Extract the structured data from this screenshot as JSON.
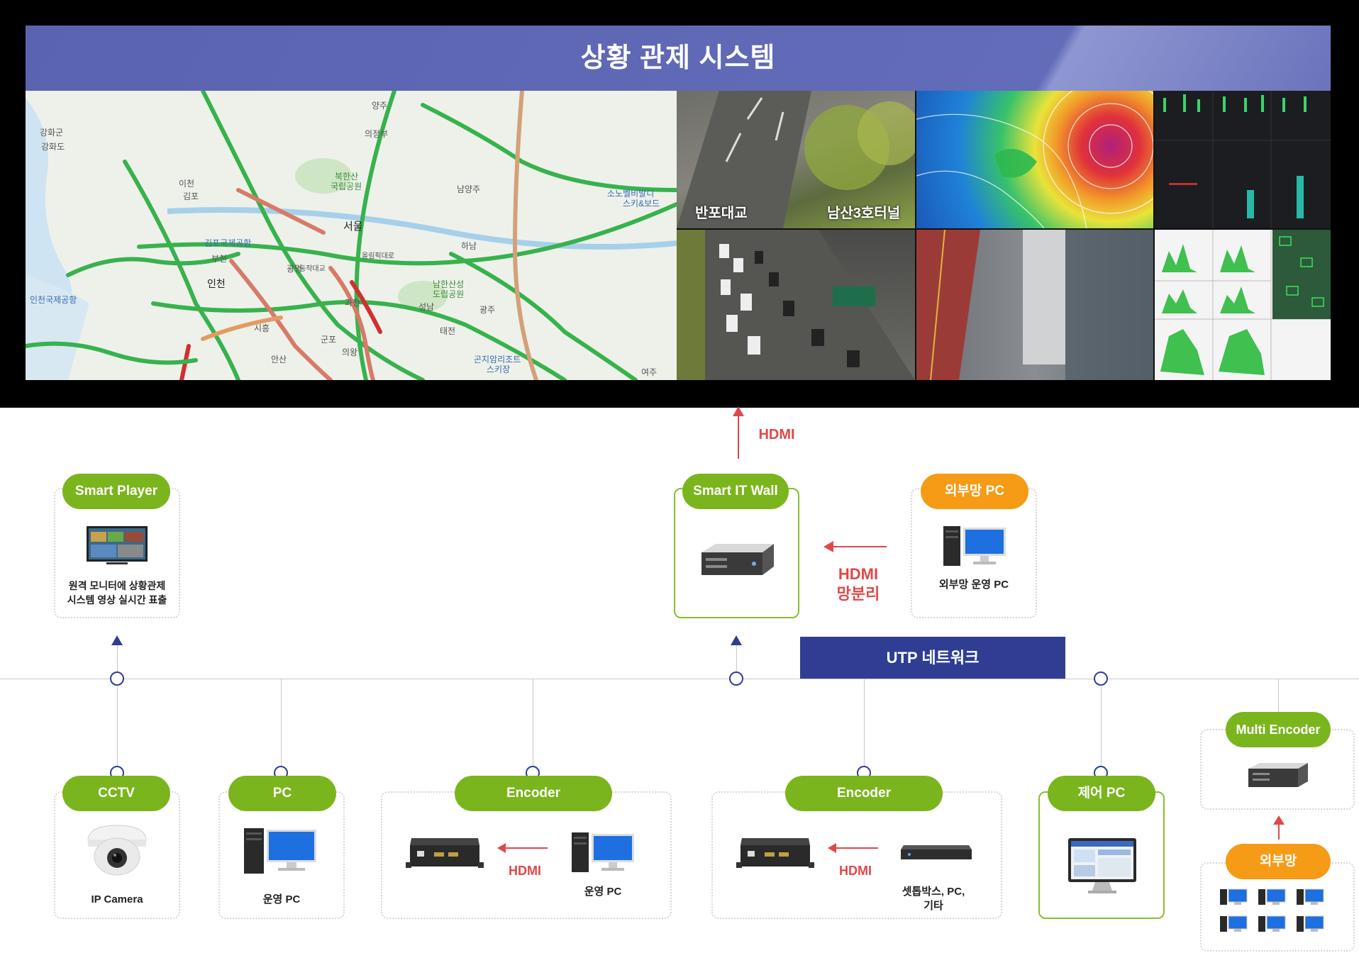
{
  "wall": {
    "title": "상황 관제 시스템",
    "map_labels": [
      "강화군",
      "강화도",
      "김포",
      "이천",
      "양주",
      "의정부",
      "북한산",
      "국립공원",
      "남양주",
      "서울",
      "광명",
      "인천",
      "시흥",
      "안산",
      "군포",
      "의왕",
      "과천",
      "성남",
      "하남",
      "남한산성",
      "도립공원",
      "곤지암리조트",
      "스키장",
      "여주",
      "부천",
      "김포국제공항",
      "인천국제공항",
      "소노벨비발디",
      "스키&보드",
      "광주",
      "태전",
      "동작대교",
      "올림픽대로"
    ],
    "cctv_labels": [
      "반포대교",
      "남산3호터널"
    ]
  },
  "diagram": {
    "hdmi_up": "HDMI",
    "smart_player": {
      "title": "Smart Player",
      "caption_line1": "원격 모니터에 상황관제",
      "caption_line2": "시스템 영상 실시간 표출"
    },
    "smart_it_wall": {
      "title": "Smart IT Wall"
    },
    "ext_pc": {
      "title": "외부망 PC",
      "caption": "외부망 운영 PC"
    },
    "hdmi_split": {
      "line1": "HDMI",
      "line2": "망분리"
    },
    "utp": "UTP 네트워크",
    "cctv": {
      "title": "CCTV",
      "caption": "IP Camera"
    },
    "pc": {
      "title": "PC",
      "caption": "운영 PC"
    },
    "encoder1": {
      "title": "Encoder",
      "hdmi": "HDMI",
      "caption": "운영 PC"
    },
    "encoder2": {
      "title": "Encoder",
      "hdmi": "HDMI",
      "caption_line1": "셋톱박스, PC,",
      "caption_line2": "기타"
    },
    "control_pc": {
      "title": "제어 PC"
    },
    "multi_encoder": {
      "title": "Multi Encoder"
    },
    "ext_net": {
      "title": "외부망"
    },
    "colors": {
      "green": "#7ab51d",
      "orange": "#f59b16",
      "navy": "#2f3e93",
      "red": "#e04848",
      "header": "#5a63b0"
    }
  }
}
